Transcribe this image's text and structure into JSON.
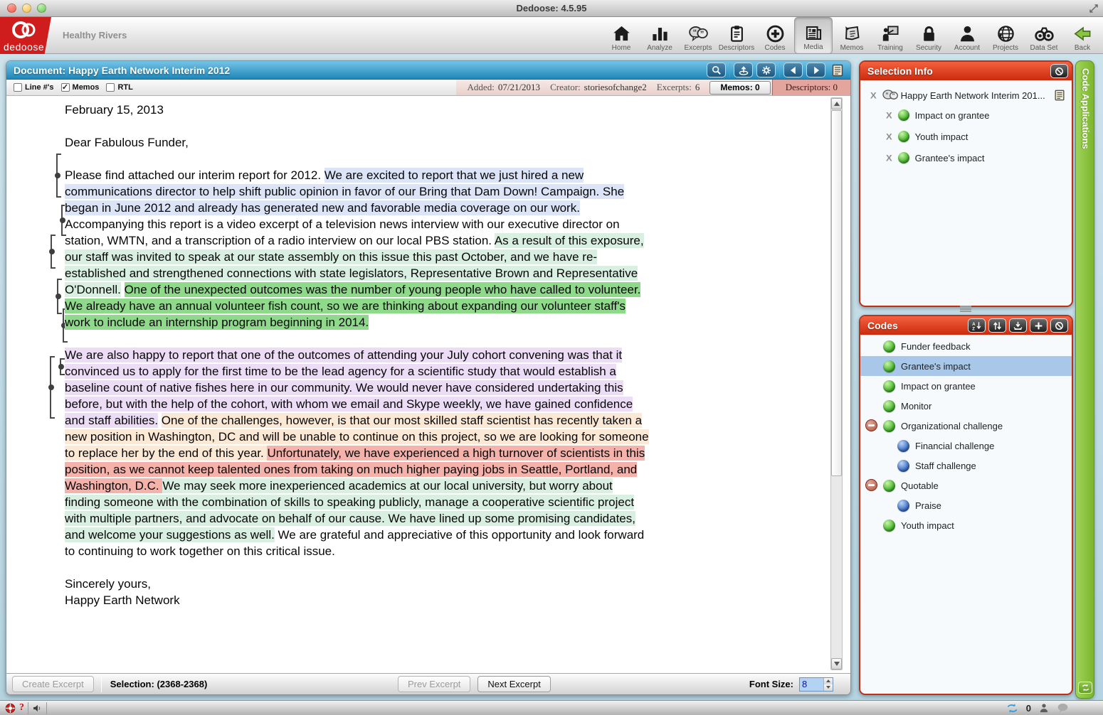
{
  "window": {
    "title": "Dedoose: 4.5.95"
  },
  "app_header": {
    "brand": "dedoose",
    "project_name": "Healthy Rivers",
    "toolbar": [
      {
        "label": "Home",
        "icon": "home-icon"
      },
      {
        "label": "Analyze",
        "icon": "analyze-icon"
      },
      {
        "label": "Excerpts",
        "icon": "excerpts-icon"
      },
      {
        "label": "Descriptors",
        "icon": "descriptors-icon"
      },
      {
        "label": "Codes",
        "icon": "codes-icon"
      },
      {
        "label": "Media",
        "icon": "media-icon",
        "active": true
      },
      {
        "label": "Memos",
        "icon": "memos-icon"
      },
      {
        "label": "Training",
        "icon": "training-icon"
      },
      {
        "label": "Security",
        "icon": "security-icon"
      },
      {
        "label": "Account",
        "icon": "account-icon"
      },
      {
        "label": "Projects",
        "icon": "projects-icon"
      },
      {
        "label": "Data Set",
        "icon": "dataset-icon"
      },
      {
        "label": "Back",
        "icon": "back-icon"
      }
    ]
  },
  "document_panel": {
    "title": "Document: Happy Earth Network Interim 2012",
    "checkboxes": [
      {
        "label": "Line #'s",
        "checked": false
      },
      {
        "label": "Memos",
        "checked": true
      },
      {
        "label": "RTL",
        "checked": false
      }
    ],
    "header_buttons": [
      {
        "name": "search-button",
        "icon": "search-icon"
      },
      {
        "name": "export-button",
        "icon": "export-icon"
      },
      {
        "name": "settings-button",
        "icon": "gear-icon"
      },
      {
        "name": "prev-doc-button",
        "icon": "arrow-left-icon"
      },
      {
        "name": "next-doc-button",
        "icon": "arrow-right-icon"
      },
      {
        "name": "excerpt-list-button",
        "icon": "doc-list-icon"
      }
    ],
    "meta": {
      "added_label": "Added:",
      "added_value": "07/21/2013",
      "creator_label": "Creator:",
      "creator_value": "storiesofchange2",
      "excerpts_label": "Excerpts:",
      "excerpts_value": "6",
      "memos_tab": "Memos: 0",
      "descriptors_tab": "Descriptors:  0"
    },
    "letter": {
      "date": "February 15, 2013",
      "salutation": "Dear Fabulous Funder,",
      "paragraphs": [
        {
          "segments": [
            {
              "text": "Please find attached our interim report for 2012. ",
              "highlight": null
            },
            {
              "text": "We are excited to report that we just hired a new communications director to help shift public opinion in favor of our Bring that Dam Down! Campaign. She began in June 2012 and already has generated new and favorable media coverage on our work.",
              "highlight": "#dce4f7"
            },
            {
              "text": " Accompanying this report is a video excerpt of a television news interview with our executive director on station, WMTN, and a transcription of a radio interview on our local PBS station. ",
              "highlight": null
            },
            {
              "text": "As a result of this exposure, our staff was invited to speak at our state assembly on this issue this past October, and we have re-established and strengthened connections with state legislators, Representative Brown and Representative O'Donnell.",
              "highlight": "#d9efe2"
            },
            {
              "text": " ",
              "highlight": null
            },
            {
              "text": "One of the unexpected outcomes was the number of young people who have called to volunteer. We already have an annual volunteer fish count, so we are thinking about expanding our volunteer staff's work to include an internship program beginning in 2014.",
              "highlight": "#8fd98b"
            }
          ]
        },
        {
          "segments": [
            {
              "text": "We are also happy to report that one of the outcomes of attending your July cohort convening was that it convinced us to apply for the first time to be the lead agency for a scientific study that would establish a baseline count of native fishes here in our community. We would never have considered undertaking this before, but with the help of the cohort, with whom we email and Skype weekly, we have gained confidence and staff abilities.",
              "highlight": "#ecdcf5"
            },
            {
              "text": " ",
              "highlight": null
            },
            {
              "text": "One of the challenges, however, is that our most skilled staff scientist has recently taken a new position in Washington, DC and will be unable to continue on this project, so we are looking for someone to replace her by the end of this year. ",
              "highlight": "#fce9d5"
            },
            {
              "text": "Unfortunately, we have experienced a high turnover of scientists in this position, as we cannot keep talented ones from taking on much higher paying jobs in Seattle, Portland, and Washington, D.C. ",
              "highlight": "#f5b2aa"
            },
            {
              "text": "We may seek more inexperienced academics at our local university, but worry about finding someone with the combination of skills to speaking publicly, manage a cooperative scientific project with multiple partners, and advocate on behalf of our cause. We have lined up some promising candidates, and welcome your suggestions as well.",
              "highlight": "#d9efe2"
            },
            {
              "text": " We are grateful and appreciative of this opportunity and look forward to continuing to work together on this critical issue.",
              "highlight": null
            }
          ]
        }
      ],
      "closing_line1": "Sincerely yours,",
      "closing_line2": "Happy Earth Network"
    },
    "footer": {
      "create_excerpt_label": "Create Excerpt",
      "selection_text": "Selection: (2368-2368)",
      "prev_label": "Prev Excerpt",
      "next_label": "Next Excerpt",
      "font_size_label": "Font Size:",
      "font_size_value": "8"
    }
  },
  "selection_info": {
    "title": "Selection Info",
    "document_item": "Happy Earth Network Interim 201...",
    "applied_codes": [
      {
        "label": "Impact on grantee"
      },
      {
        "label": "Youth impact"
      },
      {
        "label": "Grantee's impact"
      }
    ]
  },
  "codes_panel": {
    "title": "Codes",
    "items": [
      {
        "label": "Funder feedback",
        "color": "green",
        "indent": 0
      },
      {
        "label": "Grantee's impact",
        "color": "green",
        "indent": 0,
        "selected": true
      },
      {
        "label": "Impact on grantee",
        "color": "green",
        "indent": 0
      },
      {
        "label": "Monitor",
        "color": "green",
        "indent": 0
      },
      {
        "label": "Organizational challenge",
        "color": "green",
        "indent": 0,
        "collapsible": true
      },
      {
        "label": "Financial challenge",
        "color": "blue",
        "indent": 1
      },
      {
        "label": "Staff challenge",
        "color": "blue",
        "indent": 1
      },
      {
        "label": "Quotable",
        "color": "green",
        "indent": 0,
        "collapsible": true
      },
      {
        "label": "Praise",
        "color": "blue",
        "indent": 1
      },
      {
        "label": "Youth impact",
        "color": "green",
        "indent": 0
      }
    ]
  },
  "code_applications_tab": {
    "label": "Code Applications"
  },
  "status_bar": {
    "help_label": "?",
    "sync_count": "0"
  },
  "colors": {
    "header_blue": "#1f87b8",
    "panel_red": "#cb2a0d",
    "tab_green": "#7cb52e",
    "selected_row": "#a9c7e8"
  }
}
